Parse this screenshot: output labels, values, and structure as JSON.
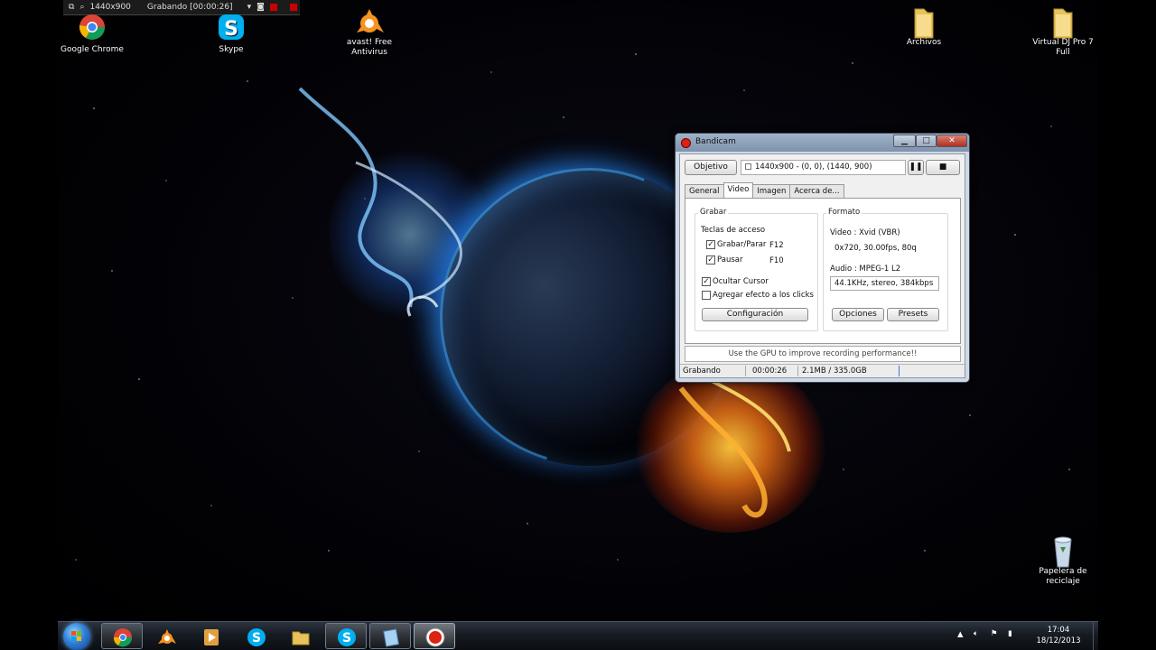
{
  "recording_bar": {
    "resolution": "1440x900",
    "status": "Grabando [00:00:26]"
  },
  "desktop_icons": [
    {
      "label": "Google Chrome",
      "icon": "chrome-icon"
    },
    {
      "label": "Skype",
      "icon": "skype-icon"
    },
    {
      "label": "avast! Free Antivirus",
      "icon": "avast-icon"
    },
    {
      "label": "Archivos",
      "icon": "folder-icon"
    },
    {
      "label": "Virtual DJ Pro 7 Full",
      "icon": "folder-icon"
    },
    {
      "label": "Papelera de reciclaje",
      "icon": "recycle-bin-icon"
    }
  ],
  "bandicam": {
    "title": "Bandicam",
    "objetivo_label": "Objetivo",
    "target_value": "1440x900 - (0, 0), (1440, 900)",
    "tabs": [
      "General",
      "Video",
      "Imagen",
      "Acerca de..."
    ],
    "active_tab": "Video",
    "grabar": {
      "group_label": "Grabar",
      "hotkeys_label": "Teclas de acceso",
      "record_label": "Grabar/Parar",
      "record_key": "F12",
      "pause_label": "Pausar",
      "pause_key": "F10",
      "hide_cursor_label": "Ocultar Cursor",
      "click_effect_label": "Agregar efecto a los clicks",
      "config_button": "Configuración"
    },
    "formato": {
      "group_label": "Formato",
      "video_line": "Video : Xvid (VBR)",
      "video_detail": "0x720, 30.00fps, 80q",
      "audio_line": "Audio : MPEG-1 L2",
      "audio_detail": "44.1KHz, stereo, 384kbps",
      "options_button": "Opciones",
      "presets_button": "Presets"
    },
    "gpu_tip": "Use the GPU to improve recording performance!!",
    "status": {
      "state": "Grabando",
      "time": "00:00:26",
      "size": "2.1MB / 335.0GB"
    }
  },
  "taskbar": {
    "items": [
      "start-orb",
      "chrome",
      "avast",
      "media-player",
      "skype-pinned",
      "explorer",
      "skype",
      "notepad",
      "bandicam"
    ],
    "time": "17:04",
    "date": "18/12/2013"
  }
}
